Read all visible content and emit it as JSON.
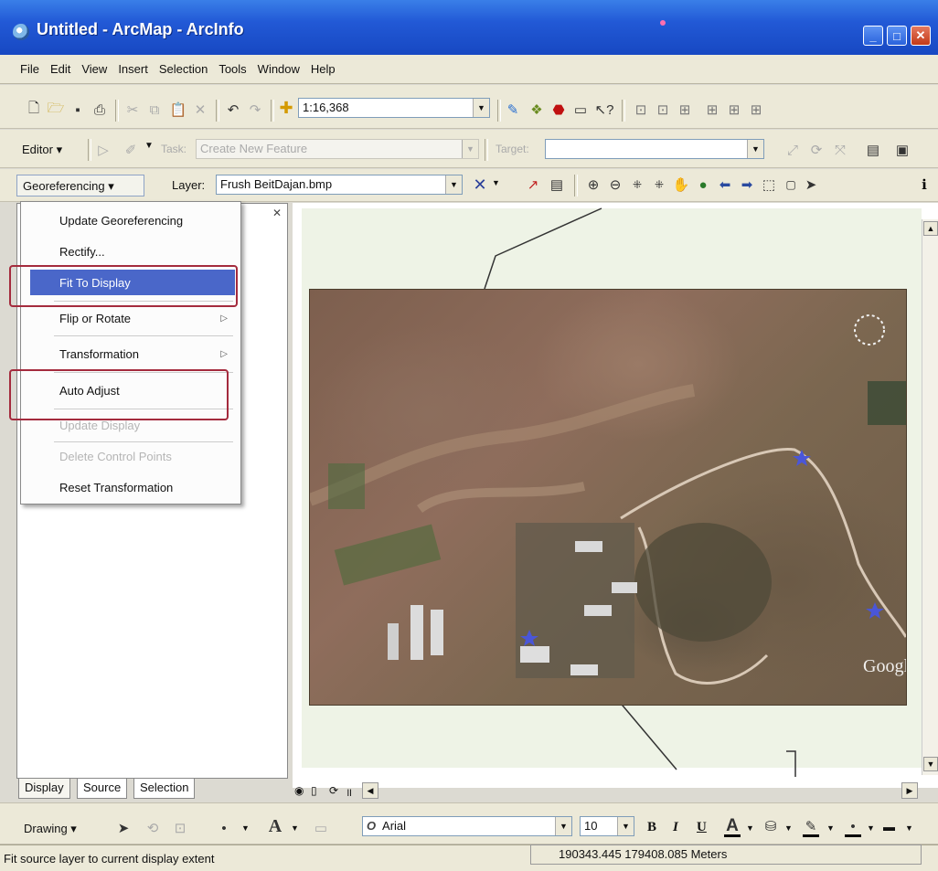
{
  "window": {
    "title": "Untitled - ArcMap - ArcInfo",
    "min": "_",
    "max": "□",
    "close": "✕"
  },
  "menu": [
    "File",
    "Edit",
    "View",
    "Insert",
    "Selection",
    "Tools",
    "Window",
    "Help"
  ],
  "standard_toolbar": {
    "scale": "1:16,368"
  },
  "editor_toolbar": {
    "editor_label": "Editor",
    "task_label": "Task:",
    "task_value": "Create New Feature",
    "target_label": "Target:",
    "target_value": ""
  },
  "georef_toolbar": {
    "georef_label": "Georeferencing",
    "layer_label": "Layer:",
    "layer_value": "Frush BeitDajan.bmp"
  },
  "georef_menu": {
    "items": [
      {
        "label": "Update Georeferencing",
        "state": "enabled"
      },
      {
        "label": "Rectify...",
        "state": "enabled"
      },
      {
        "label": "Fit To Display",
        "state": "selected"
      },
      {
        "label": "Flip or Rotate",
        "state": "enabled",
        "submenu": true
      },
      {
        "label": "Transformation",
        "state": "enabled",
        "submenu": true
      },
      {
        "label": "Auto Adjust",
        "state": "enabled"
      },
      {
        "label": "Update Display",
        "state": "disabled"
      },
      {
        "label": "Delete Control Points",
        "state": "disabled"
      },
      {
        "label": "Reset Transformation",
        "state": "enabled"
      }
    ]
  },
  "toc_tabs": [
    "Display",
    "Source",
    "Selection"
  ],
  "map": {
    "watermark": "Google"
  },
  "drawing_toolbar": {
    "drawing_label": "Drawing",
    "font_name": "Arial",
    "font_size": "10",
    "bold": "B",
    "italic": "I",
    "underline": "U"
  },
  "status": {
    "message": "Fit source layer to current display extent",
    "coordinates": "190343.445  179408.085 Meters"
  },
  "colors": {
    "titlebar": "#2259d6",
    "menu_highlight": "#4a67c9",
    "annotation_box": "#a42b3d"
  }
}
